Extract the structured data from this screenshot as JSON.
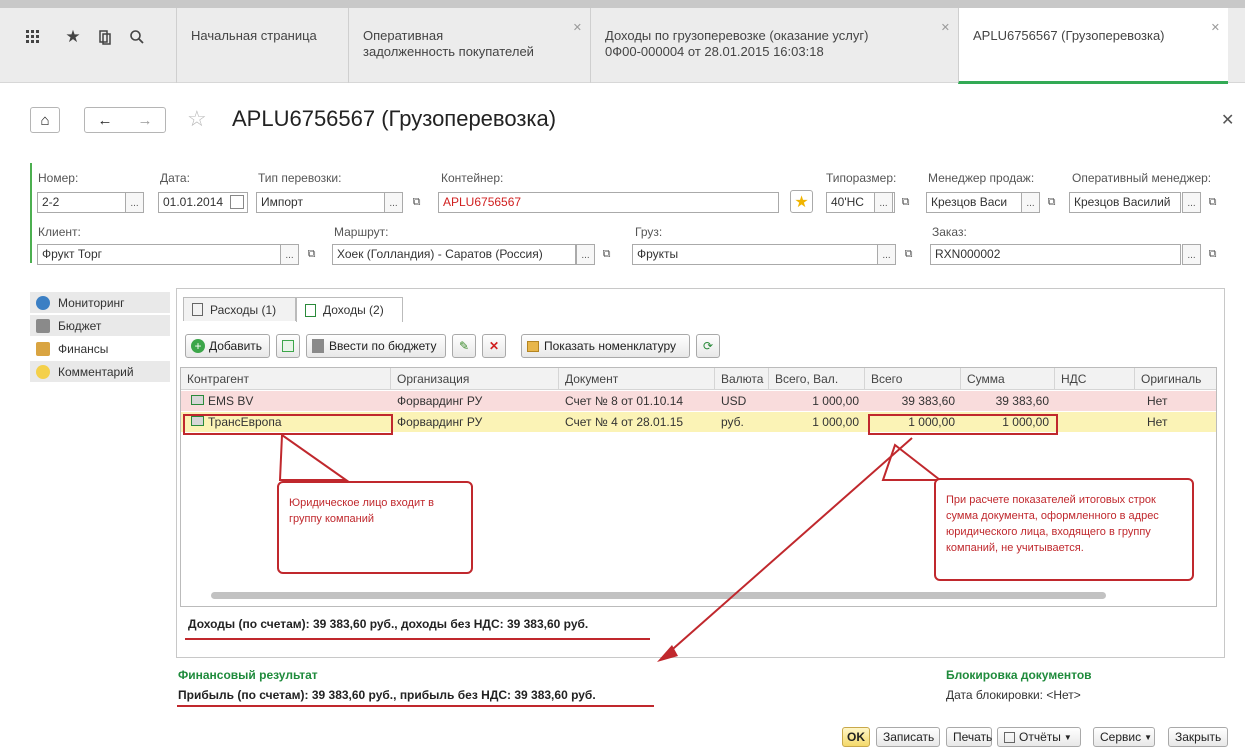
{
  "toolbar_icons": [
    "apps-grid-icon",
    "star-icon",
    "history-icon",
    "search-icon"
  ],
  "tabs": [
    {
      "label": "Начальная страница"
    },
    {
      "label1": "Оперативная",
      "label2": "задолженность покупателей"
    },
    {
      "label1": "Доходы по грузоперевозке (оказание услуг)",
      "label2": "0Ф00-000004 от 28.01.2015 16:03:18"
    },
    {
      "label": "APLU6756567 (Грузоперевозка)"
    }
  ],
  "header": {
    "title": "APLU6756567 (Грузоперевозка)"
  },
  "form": {
    "number_label": "Номер:",
    "number": "2-2",
    "date_label": "Дата:",
    "date": "01.01.2014",
    "transport_type_label": "Тип перевозки:",
    "transport_type": "Импорт",
    "container_label": "Контейнер:",
    "container": "APLU6756567",
    "size_label": "Типоразмер:",
    "size": "40'HC",
    "sales_manager_label": "Менеджер продаж:",
    "sales_manager": "Крезцов Васи",
    "op_manager_label": "Оперативный менеджер:",
    "op_manager": "Крезцов Василий",
    "client_label": "Клиент:",
    "client": "Фрукт Торг",
    "route_label": "Маршрут:",
    "route": "Хоек (Голландия) - Саратов (Россия)",
    "cargo_label": "Груз:",
    "cargo": "Фрукты",
    "order_label": "Заказ:",
    "order": "RXN000002",
    "ellipsis": "...",
    "copy_glyph": "⧉"
  },
  "left_nav": [
    {
      "label": "Мониторинг",
      "color": "#3b7fc4"
    },
    {
      "label": "Бюджет",
      "color": "#8a8a8a"
    },
    {
      "label": "Финансы",
      "color": "#d9a441"
    },
    {
      "label": "Комментарий",
      "color": "#f4d04a"
    }
  ],
  "panel_tabs": [
    "Расходы (1)",
    "Доходы (2)"
  ],
  "toolbar": {
    "add": "Добавить",
    "enter_budget": "Ввести по бюджету",
    "show_nomenclature": "Показать номенклатуру"
  },
  "grid": {
    "columns": [
      "Контрагент",
      "Организация",
      "Документ",
      "Валюта",
      "Всего, Вал.",
      "Всего",
      "Сумма",
      "НДС",
      "Оригиналь"
    ],
    "rows": [
      [
        "EMS BV",
        "Форвардинг РУ",
        "Счет № 8 от 01.10.14",
        "USD",
        "1 000,00",
        "39 383,60",
        "39 383,60",
        "",
        "Нет"
      ],
      [
        "ТрансЕвропа",
        "Форвардинг РУ",
        "Счет № 4 от 28.01.15",
        "руб.",
        "1 000,00",
        "1 000,00",
        "1 000,00",
        "",
        "Нет"
      ]
    ],
    "row_colors": [
      "#f9dcdc",
      "#fbf3b6"
    ]
  },
  "totals": "Доходы (по счетам): 39 383,60 руб., доходы без НДС: 39 383,60 руб.",
  "financial": {
    "heading": "Финансовый результат",
    "profit": "Прибыль (по счетам): 39 383,60 руб., прибыль без НДС: 39 383,60 руб."
  },
  "blocking": {
    "heading": "Блокировка документов",
    "date": "Дата блокировки: <Нет>"
  },
  "callouts": {
    "left": "Юридическое лицо входит в группу компаний",
    "right": "При расчете показателей итоговых строк сумма документа, оформленного в адрес юридического лица, входящего в группу компаний, не учитывается."
  },
  "footer": {
    "ok": "OK",
    "save": "Записать",
    "print": "Печать",
    "reports": "Отчёты",
    "service": "Сервис",
    "close": "Закрыть"
  },
  "colors": {
    "accent_green": "#1f8b3c",
    "annotation_red": "#c0282d"
  }
}
